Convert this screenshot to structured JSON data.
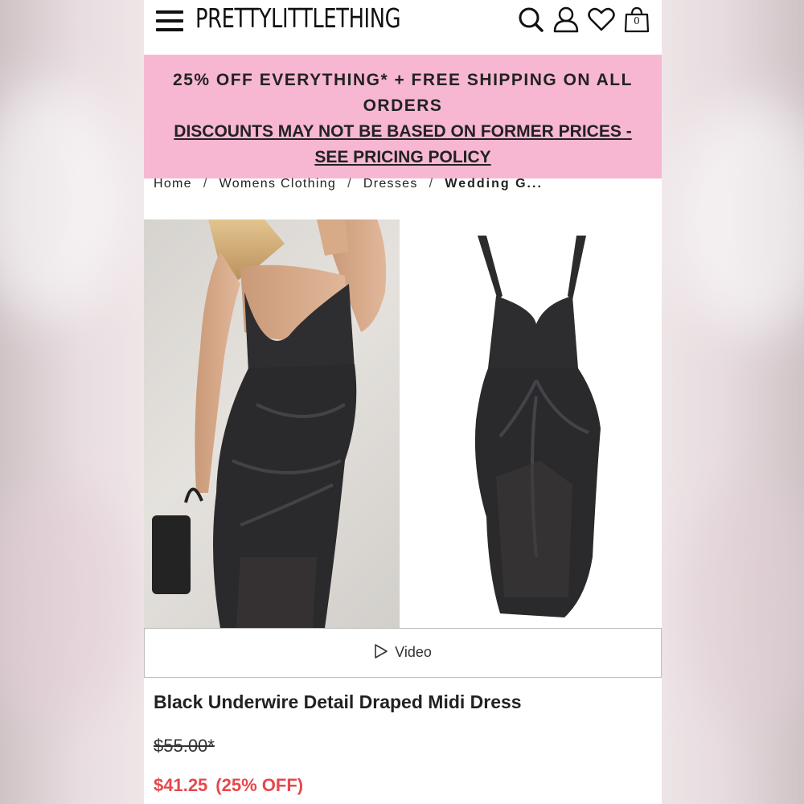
{
  "header": {
    "logo": "PRETTYLITTLETHING",
    "bag_count": "0",
    "icons": [
      "menu-icon",
      "search-icon",
      "account-icon",
      "wishlist-icon",
      "bag-icon"
    ]
  },
  "promo": {
    "line1": "25% OFF EVERYTHING* + FREE SHIPPING ON ALL ORDERS",
    "line2": "DISCOUNTS MAY NOT BE BASED ON FORMER PRICES - SEE PRICING POLICY",
    "background": "#f7b7d2"
  },
  "breadcrumb": {
    "items": [
      "Home",
      "Womens Clothing",
      "Dresses",
      "Wedding G..."
    ],
    "separator": "/"
  },
  "video": {
    "label": "Video",
    "icon": "play-icon"
  },
  "product": {
    "title": "Black Underwire Detail Draped Midi Dress",
    "old_price": "$55.00*",
    "new_price": "$41.25",
    "discount": "(25% OFF)",
    "sale_color": "#e5484d"
  }
}
